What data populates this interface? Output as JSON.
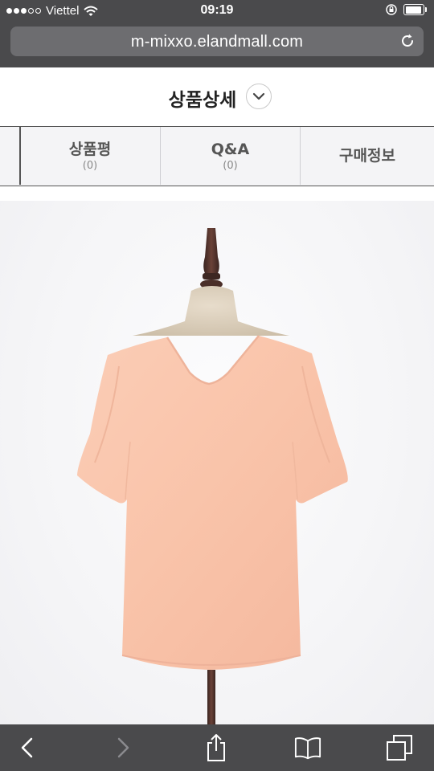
{
  "status_bar": {
    "carrier": "Viettel",
    "time": "09:19",
    "signal_bars_filled": 3,
    "signal_bars_total": 5,
    "battery_level": 0.95,
    "icons": [
      "wifi-icon",
      "rotation-lock-icon",
      "battery-icon"
    ]
  },
  "browser": {
    "url": "m-mixxo.elandmall.com",
    "reload_icon": "reload-icon"
  },
  "page": {
    "title": "상품상세",
    "toggle_icon": "chevron-down-icon"
  },
  "tabs": [
    {
      "label": "상품평",
      "count": "(0)"
    },
    {
      "label": "Q&A",
      "count": "(0)"
    },
    {
      "label": "구매정보",
      "count": ""
    }
  ],
  "product_image": {
    "description_icon": "peach-blouse-on-mannequin-image",
    "garment_color": "#f9c4ac",
    "mannequin_color": "#d9cdbb",
    "stand_color": "#4a2e28"
  },
  "toolbar": {
    "items": [
      {
        "name": "back-icon",
        "enabled": true
      },
      {
        "name": "forward-icon",
        "enabled": false
      },
      {
        "name": "share-icon",
        "enabled": true
      },
      {
        "name": "bookmarks-icon",
        "enabled": true
      },
      {
        "name": "tabs-icon",
        "enabled": true
      }
    ]
  },
  "colors": {
    "chrome": "#4a4a4c",
    "url_field": "#6d6d70",
    "tab_background": "#f4f4f6",
    "tab_border": "#555555"
  }
}
